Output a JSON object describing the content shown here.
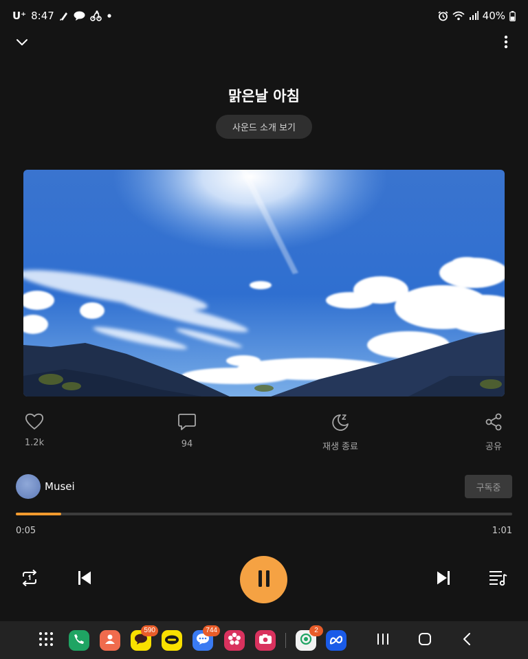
{
  "status_bar": {
    "carrier": "U⁺",
    "time": "8:47",
    "battery": "40%",
    "notification_icons": [
      "pen-app-icon",
      "chat-bubble-icon",
      "delivery-icon",
      "dot-icon"
    ],
    "system_icons": [
      "alarm-icon",
      "wifi-icon",
      "signal-icon",
      "battery-icon"
    ]
  },
  "header": {
    "collapse_icon": "chevron-down-icon",
    "more_icon": "more-vertical-icon"
  },
  "track": {
    "title": "맑은날 아침",
    "intro_button": "사운드 소개 보기",
    "artwork": "blue sky with clouds over mountains"
  },
  "actions": [
    {
      "icon": "heart-icon",
      "label": "1.2k"
    },
    {
      "icon": "comment-icon",
      "label": "94"
    },
    {
      "icon": "sleep-timer-icon",
      "label": "재생 종료"
    },
    {
      "icon": "share-icon",
      "label": "공유"
    }
  ],
  "channel": {
    "name": "Musei",
    "subscribe_label": "구독중"
  },
  "progress": {
    "elapsed": "0:05",
    "duration": "1:01",
    "fraction": 0.0915
  },
  "controls": {
    "repeat_icon": "repeat-one-icon",
    "prev_icon": "skip-previous-icon",
    "play_pause_icon": "pause-icon",
    "next_icon": "skip-next-icon",
    "queue_icon": "playlist-icon"
  },
  "taskbar": {
    "apps": [
      {
        "name": "apps-grid-icon"
      },
      {
        "name": "phone-app-icon"
      },
      {
        "name": "contacts-app-icon"
      },
      {
        "name": "kakaotalk-app-icon",
        "badge": "590"
      },
      {
        "name": "kakaopay-app-icon"
      },
      {
        "name": "messages-app-icon",
        "badge": "744"
      },
      {
        "name": "gallery-app-icon"
      },
      {
        "name": "camera-app-icon"
      },
      {
        "name": "recent-app-icon",
        "badge": "2"
      },
      {
        "name": "meta-app-icon"
      }
    ],
    "nav": [
      "recents-icon",
      "home-icon",
      "back-icon"
    ]
  },
  "colors": {
    "background": "#141414",
    "accent": "#f5a243",
    "progress": "#f29a2e",
    "badge": "#e85d2a"
  }
}
